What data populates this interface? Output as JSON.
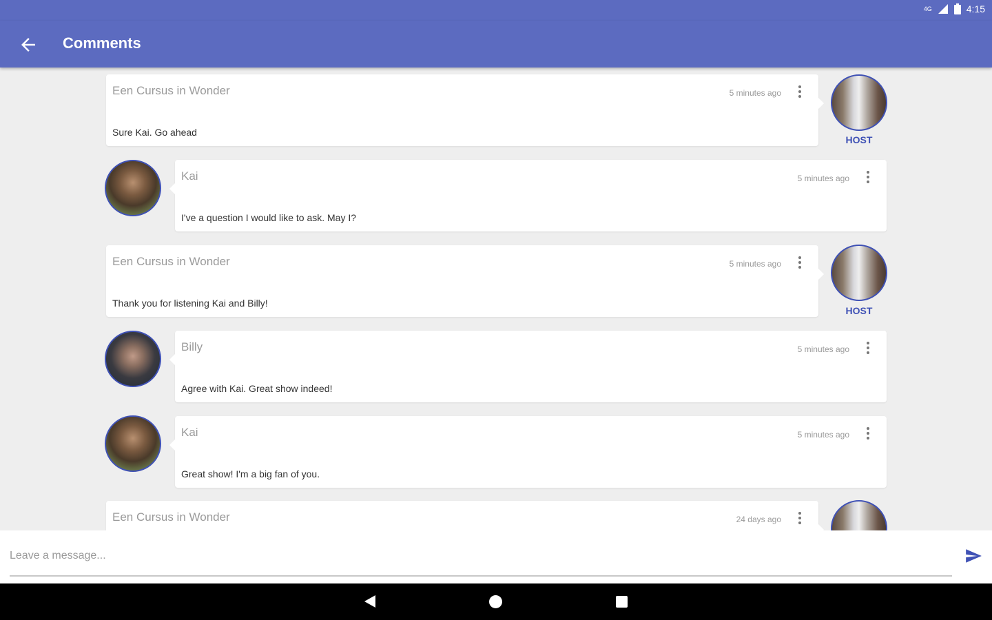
{
  "status_bar": {
    "time": "4:15",
    "network": "4G"
  },
  "app_bar": {
    "title": "Comments"
  },
  "host_label": "HOST",
  "comments": [
    {
      "author": "Een Cursus in Wonder",
      "time": "5 minutes ago",
      "message": "Sure Kai. Go ahead",
      "role": "host"
    },
    {
      "author": "Kai",
      "time": "5 minutes ago",
      "message": "I've a question I would like to ask. May I?",
      "role": "user"
    },
    {
      "author": "Een Cursus in Wonder",
      "time": "5 minutes ago",
      "message": "Thank you for listening Kai and Billy!",
      "role": "host"
    },
    {
      "author": "Billy",
      "time": "5 minutes ago",
      "message": "Agree with Kai. Great show indeed!",
      "role": "user"
    },
    {
      "author": "Kai",
      "time": "5 minutes ago",
      "message": "Great show! I'm a big fan of you.",
      "role": "user"
    },
    {
      "author": "Een Cursus in Wonder",
      "time": "24 days ago",
      "message": "",
      "role": "host"
    }
  ],
  "composer": {
    "placeholder": "Leave a message..."
  },
  "colors": {
    "primary": "#5c6bc0",
    "accent": "#3f51b5"
  }
}
